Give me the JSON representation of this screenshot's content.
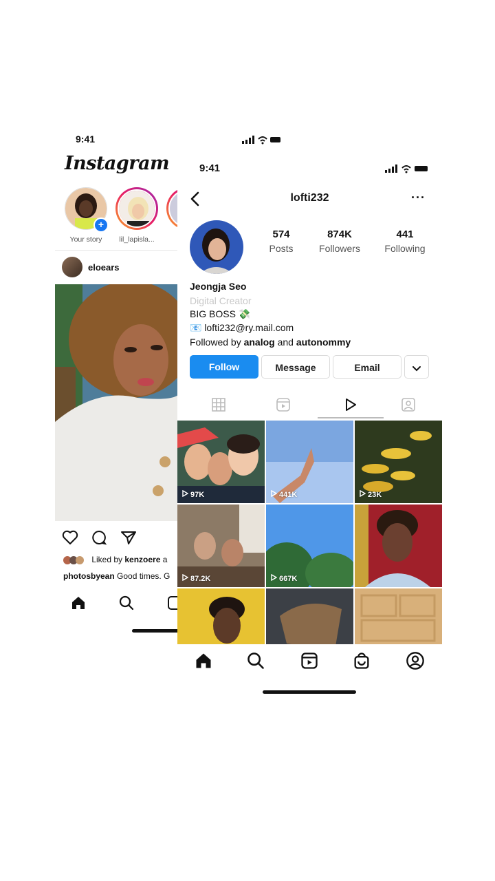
{
  "feed_screen": {
    "status_time": "9:41",
    "app_logo": "Instagram",
    "stories": [
      {
        "label": "Your story"
      },
      {
        "label": "lil_lapisla..."
      }
    ],
    "post": {
      "username": "eloears",
      "liked_by_prefix": "Liked by ",
      "liked_by_user": "kenzoere",
      "liked_by_rest": " a",
      "caption_user": "photosbyean",
      "caption_text": " Good times. G"
    },
    "nav_icons": [
      "home-icon",
      "search-icon",
      "reels-icon"
    ]
  },
  "profile_screen": {
    "status_time": "9:41",
    "username": "lofti232",
    "more_label": "···",
    "stats": [
      {
        "value": "574",
        "label": "Posts"
      },
      {
        "value": "874K",
        "label": "Followers"
      },
      {
        "value": "441",
        "label": "Following"
      }
    ],
    "bio": {
      "name": "Jeongja Seo",
      "category": "Digital Creator",
      "line1": "BIG BOSS 💸",
      "email_line": "📧 lofti232@ry.mail.com",
      "followed_by_prefix": "Followed by ",
      "followed_by_user1": "analog",
      "followed_by_mid": " and ",
      "followed_by_user2": "autonommy"
    },
    "buttons": {
      "follow": "Follow",
      "message": "Message",
      "email": "Email"
    },
    "tabs": [
      "grid-icon",
      "reels-icon",
      "play-icon",
      "tagged-icon"
    ],
    "active_tab_index": 2,
    "grid_views": [
      "97K",
      "441K",
      "23K",
      "87.2K",
      "667K",
      "",
      "",
      "",
      ""
    ],
    "nav_icons": [
      "home-icon",
      "search-icon",
      "reels-icon",
      "shop-icon",
      "profile-icon"
    ],
    "accent_color": "#1a8cf0"
  }
}
